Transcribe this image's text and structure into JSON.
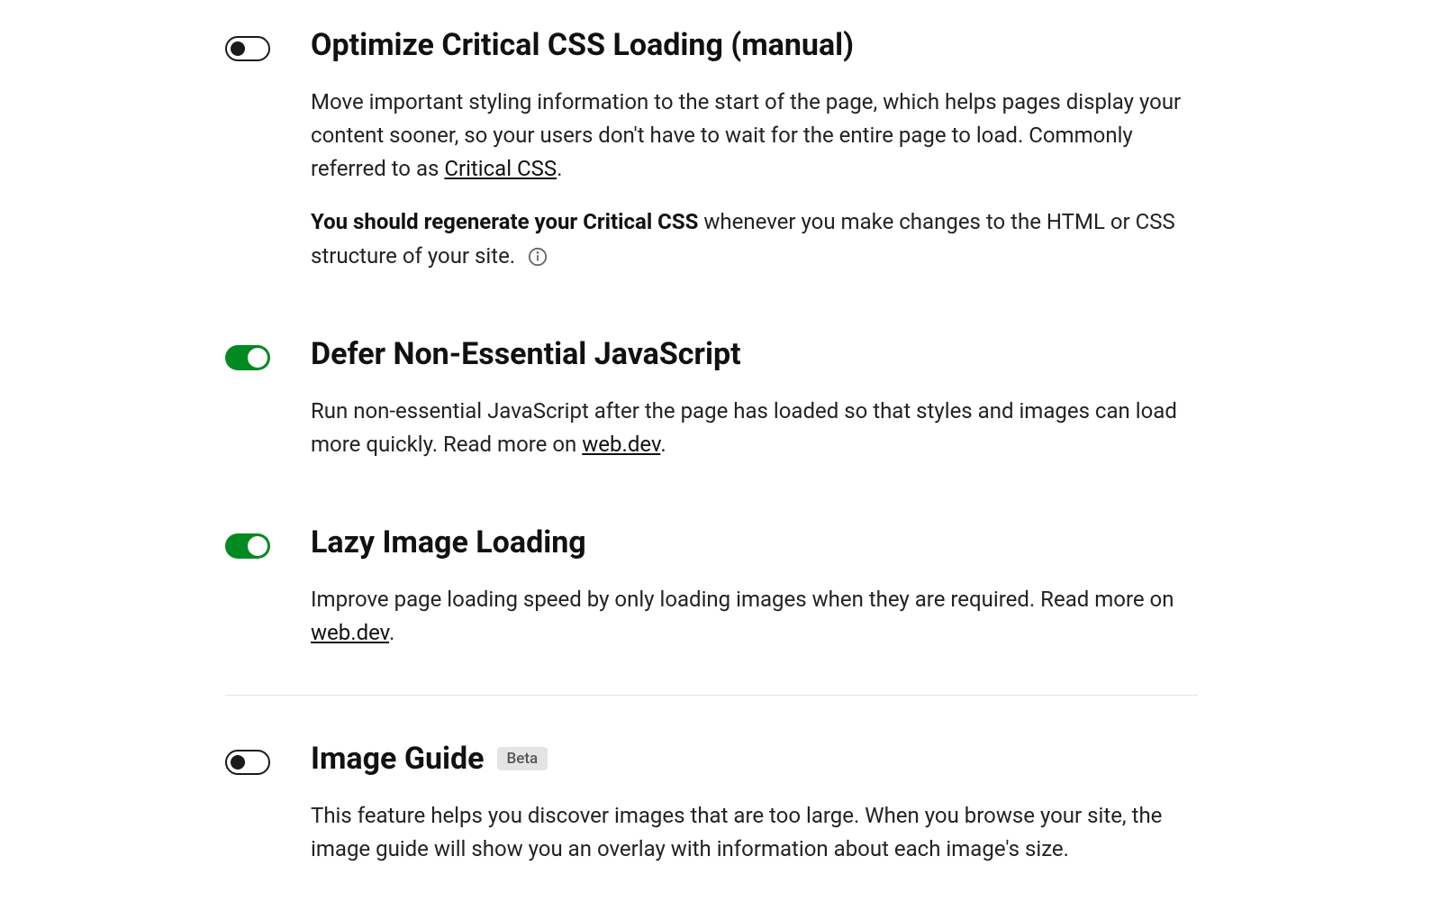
{
  "settings": {
    "optimize_css": {
      "enabled": false,
      "title": "Optimize Critical CSS Loading (manual)",
      "desc_pre": "Move important styling information to the start of the page, which helps pages display your content sooner, so your users don't have to wait for the entire page to load. Commonly referred to as ",
      "desc_link": "Critical CSS",
      "desc_post": ".",
      "note_bold": "You should regenerate your Critical CSS",
      "note_rest": " whenever you make changes to the HTML or CSS structure of your site. "
    },
    "defer_js": {
      "enabled": true,
      "title": "Defer Non-Essential JavaScript",
      "desc_pre": "Run non-essential JavaScript after the page has loaded so that styles and images can load more quickly. Read more on ",
      "desc_link": "web.dev",
      "desc_post": "."
    },
    "lazy_img": {
      "enabled": true,
      "title": "Lazy Image Loading",
      "desc_pre": "Improve page loading speed by only loading images when they are required. Read more on ",
      "desc_link": "web.dev",
      "desc_post": "."
    },
    "image_guide": {
      "enabled": false,
      "title": "Image Guide",
      "badge": "Beta",
      "desc": "This feature helps you discover images that are too large. When you browse your site, the image guide will show you an overlay with information about each image's size."
    }
  }
}
